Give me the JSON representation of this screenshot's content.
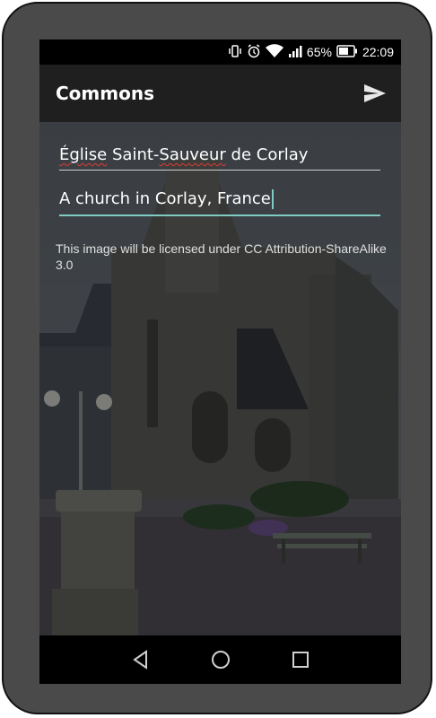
{
  "status_bar": {
    "battery_percent": "65%",
    "time": "22:09",
    "icons": [
      "vibrate-icon",
      "alarm-icon",
      "wifi-icon",
      "cell-signal-icon",
      "battery-icon"
    ]
  },
  "app_bar": {
    "title": "Commons",
    "send_icon": "send-icon"
  },
  "form": {
    "title_value": "Église Saint-Sauveur de Corlay",
    "title_parts": {
      "w1": "Église",
      "s1": " Saint-",
      "w2": "Sauveur",
      "s2": " de Corlay"
    },
    "description_value": "A church in Corlay, France",
    "license_text": "This image will be licensed under CC Attribution-ShareAlike 3.0"
  },
  "nav_bar": {
    "icons": [
      "back-icon",
      "home-icon",
      "recents-icon"
    ]
  },
  "colors": {
    "app_bar": "#1f1f1f",
    "accent": "#80cbc4",
    "device_frame": "#4a4a4a"
  }
}
